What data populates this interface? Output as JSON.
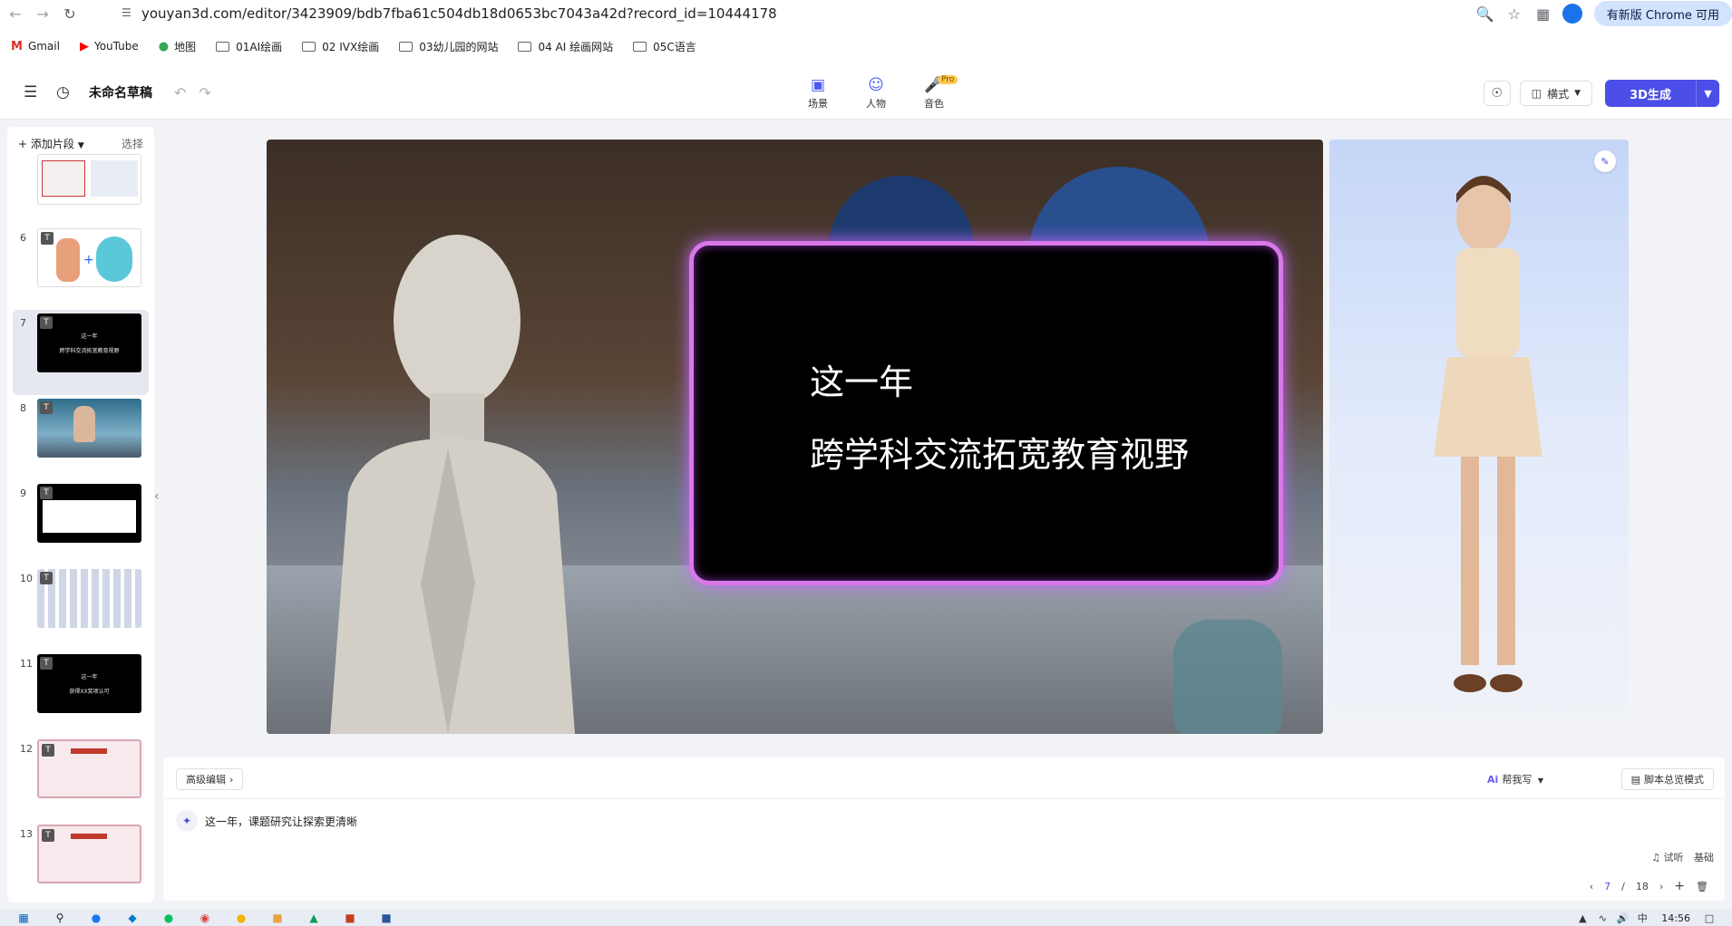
{
  "browser": {
    "url": "youyan3d.com/editor/3423909/bdb7fba61c504db18d0653bc7043a42d?record_id=10444178",
    "update_label": "有新版 Chrome 可用"
  },
  "bookmarks": [
    {
      "label": "Gmail",
      "icon": "gmail-icon"
    },
    {
      "label": "YouTube",
      "icon": "youtube-icon"
    },
    {
      "label": "地图",
      "icon": "maps-icon"
    },
    {
      "label": "01AI绘画",
      "icon": "folder-icon"
    },
    {
      "label": "02 IVX绘画",
      "icon": "folder-icon"
    },
    {
      "label": "03幼儿园的网站",
      "icon": "folder-icon"
    },
    {
      "label": "04 AI 绘画网站",
      "icon": "folder-icon"
    },
    {
      "label": "05C语言",
      "icon": "folder-icon"
    }
  ],
  "header": {
    "title": "未命名草稿",
    "tools": [
      {
        "label": "场景",
        "icon": "scene-icon"
      },
      {
        "label": "人物",
        "icon": "person-icon"
      },
      {
        "label": "音色",
        "icon": "voice-icon",
        "badge": "Pro"
      }
    ],
    "mode_label": "横式",
    "generate_label": "3D生成"
  },
  "sidebar": {
    "add_label": "添加片段",
    "select_label": "选择",
    "slides": [
      {
        "num": "",
        "kind": "doc"
      },
      {
        "num": "6",
        "kind": "cartoon"
      },
      {
        "num": "7",
        "kind": "text",
        "line1": "这一年",
        "line2": "跨学科交流拓宽教育视野",
        "active": true
      },
      {
        "num": "8",
        "kind": "photo"
      },
      {
        "num": "9",
        "kind": "table"
      },
      {
        "num": "10",
        "kind": "grid"
      },
      {
        "num": "11",
        "kind": "text",
        "line1": "这一年",
        "line2": "获得XX奖项认可"
      },
      {
        "num": "12",
        "kind": "cert"
      },
      {
        "num": "13",
        "kind": "cert"
      }
    ]
  },
  "stage": {
    "line1": "这一年",
    "line2": "跨学科交流拓宽教育视野"
  },
  "editor": {
    "advanced_label": "高级编辑",
    "help_write_label": "帮我写",
    "script_mode_label": "脚本总览模式",
    "script_text": "这一年，课题研究让探索更清晰",
    "listen_label": "试听",
    "voice_level": "基础",
    "page_current": "7",
    "page_total": "18"
  },
  "taskbar": {
    "time": "14:56"
  }
}
